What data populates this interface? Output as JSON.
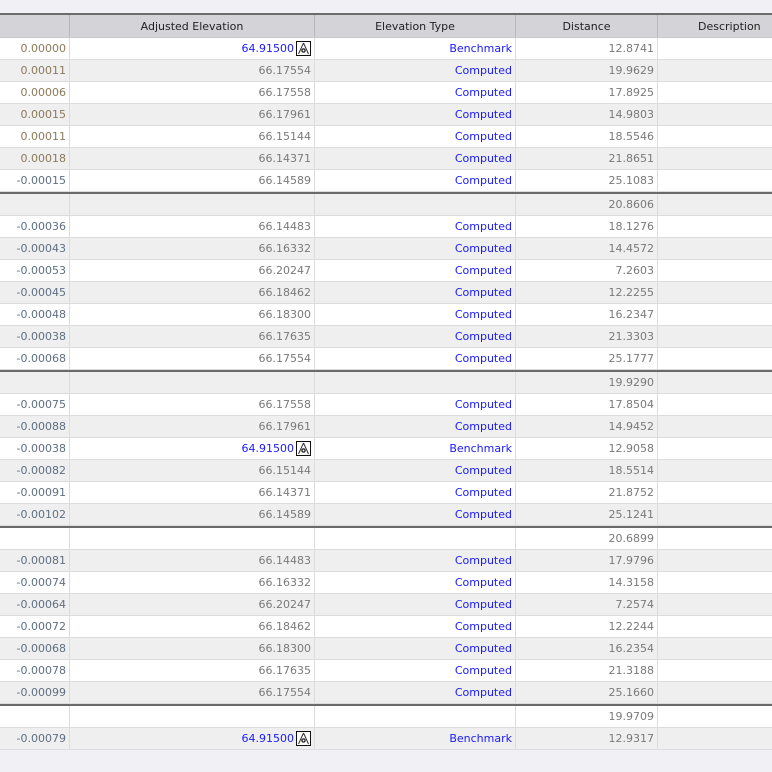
{
  "columns": [
    "",
    "Adjusted Elevation",
    "Elevation Type",
    "Distance",
    "Description"
  ],
  "rows": [
    {
      "c": "0.00000",
      "e": "64.91500",
      "t": "Benchmark",
      "d": "12.8741"
    },
    {
      "c": "0.00011",
      "e": "66.17554",
      "t": "Computed",
      "d": "19.9629"
    },
    {
      "c": "0.00006",
      "e": "66.17558",
      "t": "Computed",
      "d": "17.8925"
    },
    {
      "c": "0.00015",
      "e": "66.17961",
      "t": "Computed",
      "d": "14.9803"
    },
    {
      "c": "0.00011",
      "e": "66.15144",
      "t": "Computed",
      "d": "18.5546"
    },
    {
      "c": "0.00018",
      "e": "66.14371",
      "t": "Computed",
      "d": "21.8651"
    },
    {
      "c": "-0.00015",
      "e": "66.14589",
      "t": "Computed",
      "d": "25.1083"
    },
    {
      "sep": true,
      "c": "",
      "e": "",
      "t": "",
      "d": "20.8606"
    },
    {
      "c": "-0.00036",
      "e": "66.14483",
      "t": "Computed",
      "d": "18.1276"
    },
    {
      "c": "-0.00043",
      "e": "66.16332",
      "t": "Computed",
      "d": "14.4572"
    },
    {
      "c": "-0.00053",
      "e": "66.20247",
      "t": "Computed",
      "d": "7.2603"
    },
    {
      "c": "-0.00045",
      "e": "66.18462",
      "t": "Computed",
      "d": "12.2255"
    },
    {
      "c": "-0.00048",
      "e": "66.18300",
      "t": "Computed",
      "d": "16.2347"
    },
    {
      "c": "-0.00038",
      "e": "66.17635",
      "t": "Computed",
      "d": "21.3303"
    },
    {
      "c": "-0.00068",
      "e": "66.17554",
      "t": "Computed",
      "d": "25.1777"
    },
    {
      "sep": true,
      "c": "",
      "e": "",
      "t": "",
      "d": "19.9290"
    },
    {
      "c": "-0.00075",
      "e": "66.17558",
      "t": "Computed",
      "d": "17.8504"
    },
    {
      "c": "-0.00088",
      "e": "66.17961",
      "t": "Computed",
      "d": "14.9452"
    },
    {
      "c": "-0.00038",
      "e": "64.91500",
      "t": "Benchmark",
      "d": "12.9058"
    },
    {
      "c": "-0.00082",
      "e": "66.15144",
      "t": "Computed",
      "d": "18.5514"
    },
    {
      "c": "-0.00091",
      "e": "66.14371",
      "t": "Computed",
      "d": "21.8752"
    },
    {
      "c": "-0.00102",
      "e": "66.14589",
      "t": "Computed",
      "d": "25.1241"
    },
    {
      "sep": true,
      "c": "",
      "e": "",
      "t": "",
      "d": "20.6899"
    },
    {
      "c": "-0.00081",
      "e": "66.14483",
      "t": "Computed",
      "d": "17.9796"
    },
    {
      "c": "-0.00074",
      "e": "66.16332",
      "t": "Computed",
      "d": "14.3158"
    },
    {
      "c": "-0.00064",
      "e": "66.20247",
      "t": "Computed",
      "d": "7.2574"
    },
    {
      "c": "-0.00072",
      "e": "66.18462",
      "t": "Computed",
      "d": "12.2244"
    },
    {
      "c": "-0.00068",
      "e": "66.18300",
      "t": "Computed",
      "d": "16.2354"
    },
    {
      "c": "-0.00078",
      "e": "66.17635",
      "t": "Computed",
      "d": "21.3188"
    },
    {
      "c": "-0.00099",
      "e": "66.17554",
      "t": "Computed",
      "d": "25.1660"
    },
    {
      "sep": true,
      "c": "",
      "e": "",
      "t": "",
      "d": "19.9709"
    },
    {
      "c": "-0.00079",
      "e": "64.91500",
      "t": "Benchmark",
      "d": "12.9317"
    }
  ]
}
